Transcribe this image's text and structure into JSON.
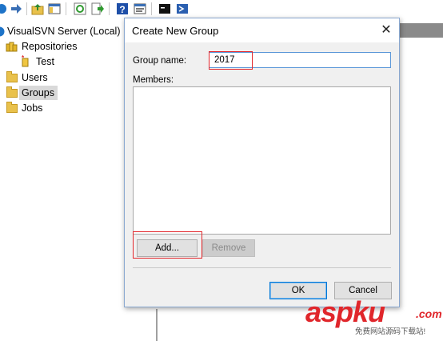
{
  "toolbar": {
    "icons": [
      "forward-arrow-icon",
      "up-folder-icon",
      "show-hide-tree-icon",
      "refresh-icon",
      "export-list-icon",
      "help-icon",
      "properties-icon",
      "console-icon",
      "powershell-icon"
    ]
  },
  "tree": {
    "root_label": "VisualSVN Server (Local)",
    "repositories_label": "Repositories",
    "repo_item_label": "Test",
    "users_label": "Users",
    "groups_label": "Groups",
    "jobs_label": "Jobs",
    "selected": "Groups"
  },
  "dialog": {
    "title": "Create New Group",
    "close_glyph": "✕",
    "group_name_label": "Group name:",
    "group_name_value": "2017",
    "members_label": "Members:",
    "add_label": "Add...",
    "remove_label": "Remove",
    "ok_label": "OK",
    "cancel_label": "Cancel"
  },
  "watermark": {
    "logo_text": "aspku",
    "logo_suffix": ".com",
    "tagline": "免费网站源码下载站!"
  },
  "colors": {
    "highlight_box": "#e3262b",
    "input_focus": "#5a97d8",
    "default_button_border": "#0078d7",
    "selection": "#d9d9d9",
    "folder": "#e9c14b"
  }
}
